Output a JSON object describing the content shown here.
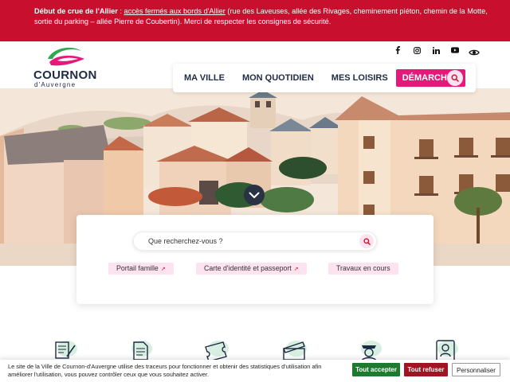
{
  "alert": {
    "title": "Début de crue de l'Allier",
    "separator": " : ",
    "link": "accès fermés aux bords d'Allier",
    "text": " (rue des Laveuses, allée des Rivages, cheminement piéton, chemin de la Motte, sortie du parking – allée Pierre de Coubertin). Merci de respecter les consignes de sécurité."
  },
  "logo": {
    "title": "COURNON",
    "subtitle": "d'Auvergne"
  },
  "social": [
    "facebook-icon",
    "instagram-icon",
    "linkedin-icon",
    "youtube-icon"
  ],
  "accessibility_icon": "eye-icon",
  "nav": {
    "items": [
      "MA VILLE",
      "MON QUOTIDIEN",
      "MES LOISIRS"
    ],
    "cta": "DÉMARCHES",
    "search_icon": "search-icon"
  },
  "search": {
    "placeholder": "Que recherchez-vous ?"
  },
  "chips": [
    {
      "label": "Portail famille",
      "external": true
    },
    {
      "label": "Carte d'identité et passeport",
      "external": true
    },
    {
      "label": "Travaux en cours",
      "external": false
    }
  ],
  "quick_icons": [
    "form-icon",
    "document-icon",
    "ticket-icon",
    "clapper-icon",
    "police-icon",
    "id-card-icon"
  ],
  "cookie": {
    "text": "Le site de la Ville de Cournon-d'Auvergne utilise des traceurs pour fonctionner et obtenir des statistiques d'utilisation afin améliorer l'utilisation, vous pouvez contrôler ceux que vous souhaitez activer.",
    "accept": "Tout accepter",
    "refuse": "Tout refuser",
    "customize": "Personnaliser"
  },
  "colors": {
    "alert_red": "#c8102e",
    "brand_pink": "#e5197a",
    "navy": "#1f2a44",
    "accept_green": "#1e7a2e",
    "refuse_red": "#a11423"
  }
}
